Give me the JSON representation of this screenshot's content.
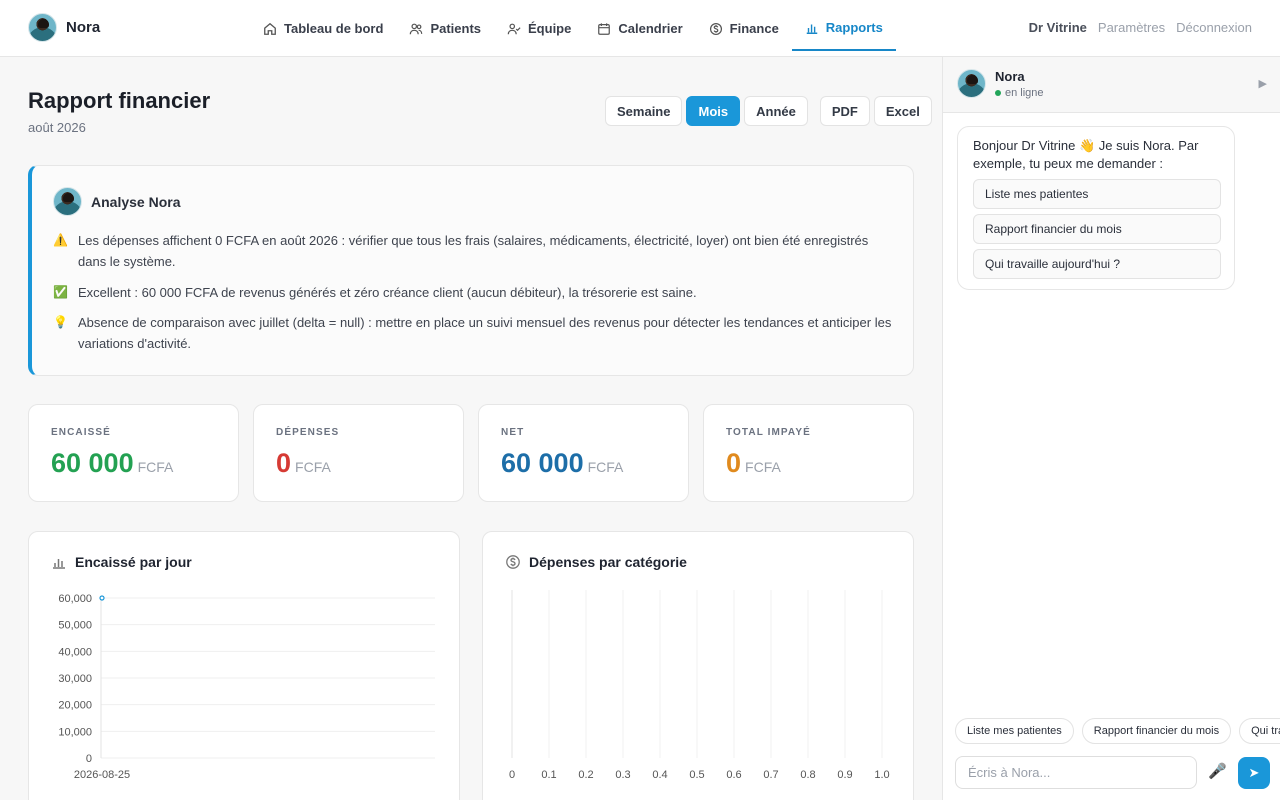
{
  "brand": {
    "name": "Nora"
  },
  "nav": {
    "items": [
      {
        "label": "Tableau de bord",
        "icon": "home-icon"
      },
      {
        "label": "Patients",
        "icon": "users-icon"
      },
      {
        "label": "Équipe",
        "icon": "team-icon"
      },
      {
        "label": "Calendrier",
        "icon": "calendar-icon"
      },
      {
        "label": "Finance",
        "icon": "dollar-icon"
      },
      {
        "label": "Rapports",
        "icon": "bar-chart-icon",
        "active": true
      }
    ]
  },
  "user_menu": {
    "user": "Dr Vitrine",
    "settings": "Paramètres",
    "logout": "Déconnexion"
  },
  "page": {
    "title": "Rapport financier",
    "subtitle": "août 2026"
  },
  "periods": {
    "week": "Semaine",
    "month": "Mois",
    "year": "Année",
    "pdf": "PDF",
    "excel": "Excel",
    "selected": "Mois"
  },
  "analysis": {
    "title": "Analyse Nora",
    "insights": [
      {
        "icon": "⚠️",
        "text": "Les dépenses affichent 0 FCFA en août 2026 : vérifier que tous les frais (salaires, médicaments, électricité, loyer) ont bien été enregistrés dans le système."
      },
      {
        "icon": "✅",
        "text": "Excellent : 60 000 FCFA de revenus générés et zéro créance client (aucun débiteur), la trésorerie est saine."
      },
      {
        "icon": "💡",
        "text": "Absence de comparaison avec juillet (delta = null) : mettre en place un suivi mensuel des revenus pour détecter les tendances et anticiper les variations d'activité."
      }
    ]
  },
  "kpis": [
    {
      "label": "ENCAISSÉ",
      "value": "60 000",
      "unit": "FCFA",
      "color": "#23a152"
    },
    {
      "label": "DÉPENSES",
      "value": "0",
      "unit": "FCFA",
      "color": "#d63a34"
    },
    {
      "label": "NET",
      "value": "60 000",
      "unit": "FCFA",
      "color": "#1d6ea8"
    },
    {
      "label": "TOTAL IMPAYÉ",
      "value": "0",
      "unit": "FCFA",
      "color": "#e08a1e"
    }
  ],
  "chart_data": [
    {
      "type": "line",
      "title": "Encaissé par jour",
      "categories": [
        "2026-08-25"
      ],
      "series": [
        {
          "values": [
            60000
          ]
        }
      ],
      "ylim": [
        0,
        60000
      ],
      "yticks": [
        "60,000",
        "50,000",
        "40,000",
        "30,000",
        "20,000",
        "10,000",
        "0"
      ],
      "grid": true
    },
    {
      "type": "bar",
      "title": "Dépenses par catégorie",
      "categories": [],
      "values": [],
      "xlim": [
        0,
        1.0
      ],
      "xticks": [
        "0",
        "0.1",
        "0.2",
        "0.3",
        "0.4",
        "0.5",
        "0.6",
        "0.7",
        "0.8",
        "0.9",
        "1.0"
      ],
      "grid": true
    }
  ],
  "chat": {
    "name": "Nora",
    "status": "en ligne",
    "greeting": "Bonjour Dr Vitrine 👋 Je suis Nora. Par exemple, tu peux me demander :",
    "suggestions": [
      "Liste mes patientes",
      "Rapport financier du mois",
      "Qui travaille aujourd'hui ?"
    ],
    "quick_chips": [
      "Liste mes patientes",
      "Rapport financier du mois",
      "Qui travaille aujourd'hui ?"
    ],
    "input_placeholder": "Écris à Nora..."
  }
}
